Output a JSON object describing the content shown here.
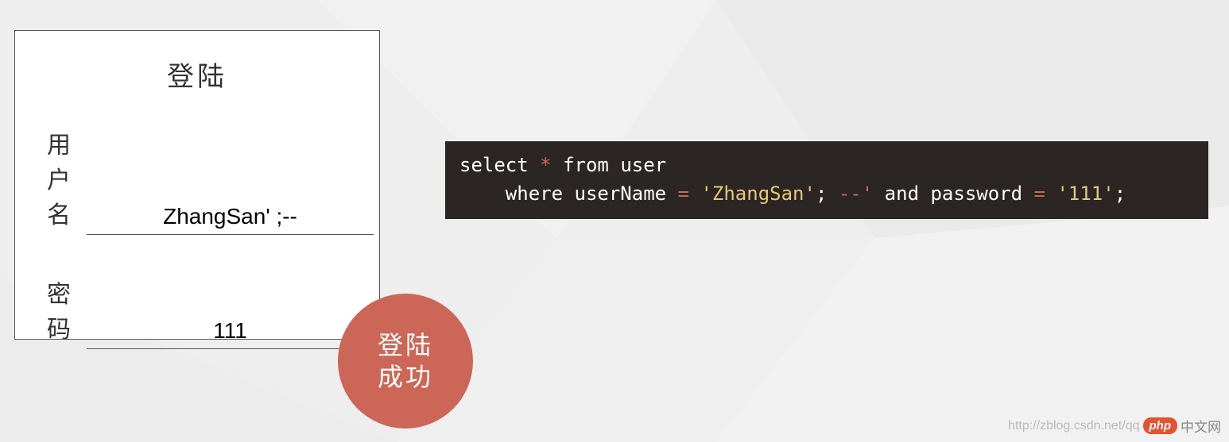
{
  "login": {
    "title": "登陆",
    "username_label": "用户名",
    "username_value": "ZhangSan' ;--",
    "password_label": "密码",
    "password_value": "111"
  },
  "result": {
    "badge_line1": "登陆",
    "badge_line2": "成功"
  },
  "sql": {
    "kw_select": "select",
    "star": "*",
    "kw_from": "from",
    "tbl": "user",
    "kw_where": "where",
    "col_user": "userName",
    "eq1": "=",
    "val_user": "'ZhangSan'",
    "semi1": ";",
    "comment": "--'",
    "kw_and": "and",
    "col_pass": "password",
    "eq2": "=",
    "val_pass": "'111'",
    "semi2": ";"
  },
  "watermark": {
    "url": "http://zblog.csdn.net/qq",
    "pill": "php",
    "tail": "中文网"
  }
}
